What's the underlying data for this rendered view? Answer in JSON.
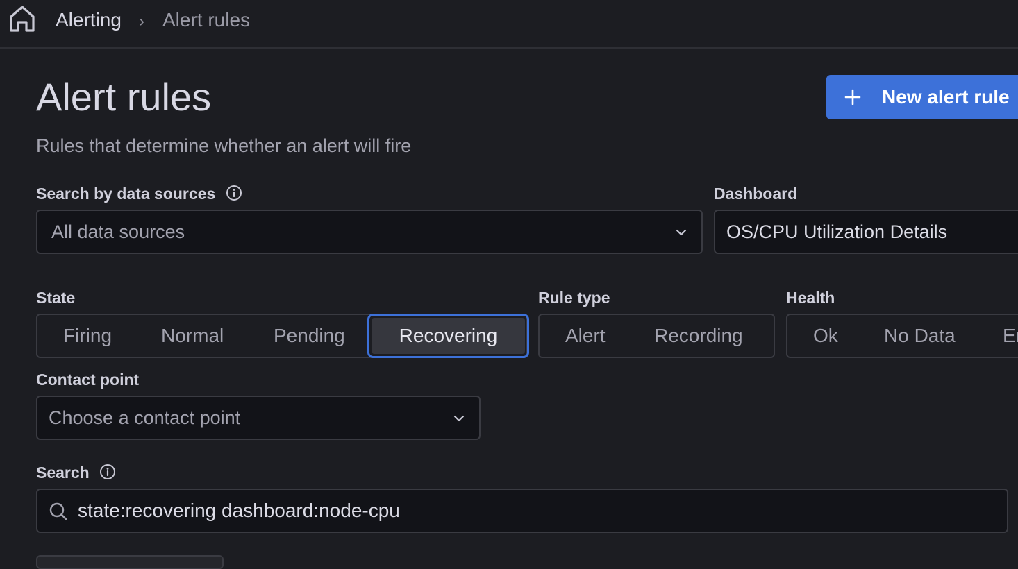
{
  "breadcrumb": {
    "items": [
      "Alerting",
      "Alert rules"
    ],
    "separator": "›"
  },
  "page": {
    "title": "Alert rules",
    "subtitle": "Rules that determine whether an alert will fire",
    "new_button": "New alert rule"
  },
  "filters": {
    "datasource": {
      "label": "Search by data sources",
      "placeholder": "All data sources"
    },
    "dashboard": {
      "label": "Dashboard",
      "value": "OS/CPU Utilization Details"
    },
    "state": {
      "label": "State",
      "options": [
        "Firing",
        "Normal",
        "Pending",
        "Recovering"
      ],
      "selected": "Recovering"
    },
    "rule_type": {
      "label": "Rule type",
      "options": [
        "Alert",
        "Recording"
      ]
    },
    "health": {
      "label": "Health",
      "options": [
        "Ok",
        "No Data",
        "Er"
      ]
    },
    "contact_point": {
      "label": "Contact point",
      "placeholder": "Choose a contact point"
    },
    "search": {
      "label": "Search",
      "value": "state:recovering dashboard:node-cpu"
    }
  },
  "colors": {
    "accent": "#3d71d9",
    "background": "#1c1d22",
    "input_bg": "#121318",
    "border": "#3a3b42"
  },
  "icons": [
    "home-icon",
    "chevron-right-icon",
    "plus-icon",
    "info-icon",
    "chevron-down-icon",
    "search-icon"
  ]
}
